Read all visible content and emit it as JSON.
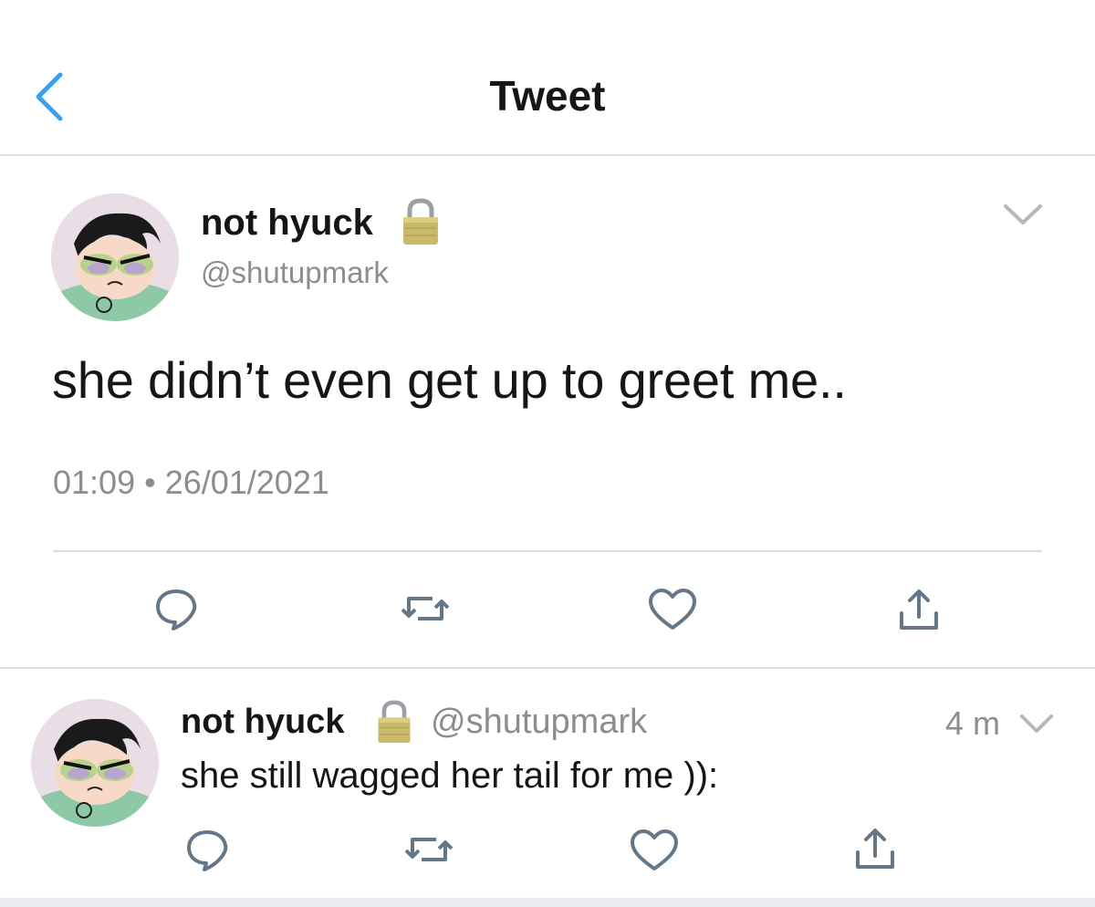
{
  "header": {
    "title": "Tweet",
    "back_icon": "chevron-left-icon"
  },
  "main_tweet": {
    "display_name": "not hyuck",
    "lock_icon": "lock-icon",
    "handle": "@shutupmark",
    "text": "she didn’t even get up to greet me..",
    "timestamp": "01:09 • 26/01/2021",
    "actions": [
      "reply-icon",
      "retweet-icon",
      "like-icon",
      "share-icon"
    ]
  },
  "reply_tweet": {
    "display_name": "not hyuck",
    "lock_icon": "lock-icon",
    "handle": "@shutupmark",
    "time": "4 m",
    "text": "she still wagged her tail for me )):",
    "actions": [
      "reply-icon",
      "retweet-icon",
      "like-icon",
      "share-icon"
    ]
  },
  "colors": {
    "accent": "#1da1f2",
    "secondary_text": "#8a8d91",
    "divider": "#dcdfe2",
    "icon": "#657786"
  }
}
